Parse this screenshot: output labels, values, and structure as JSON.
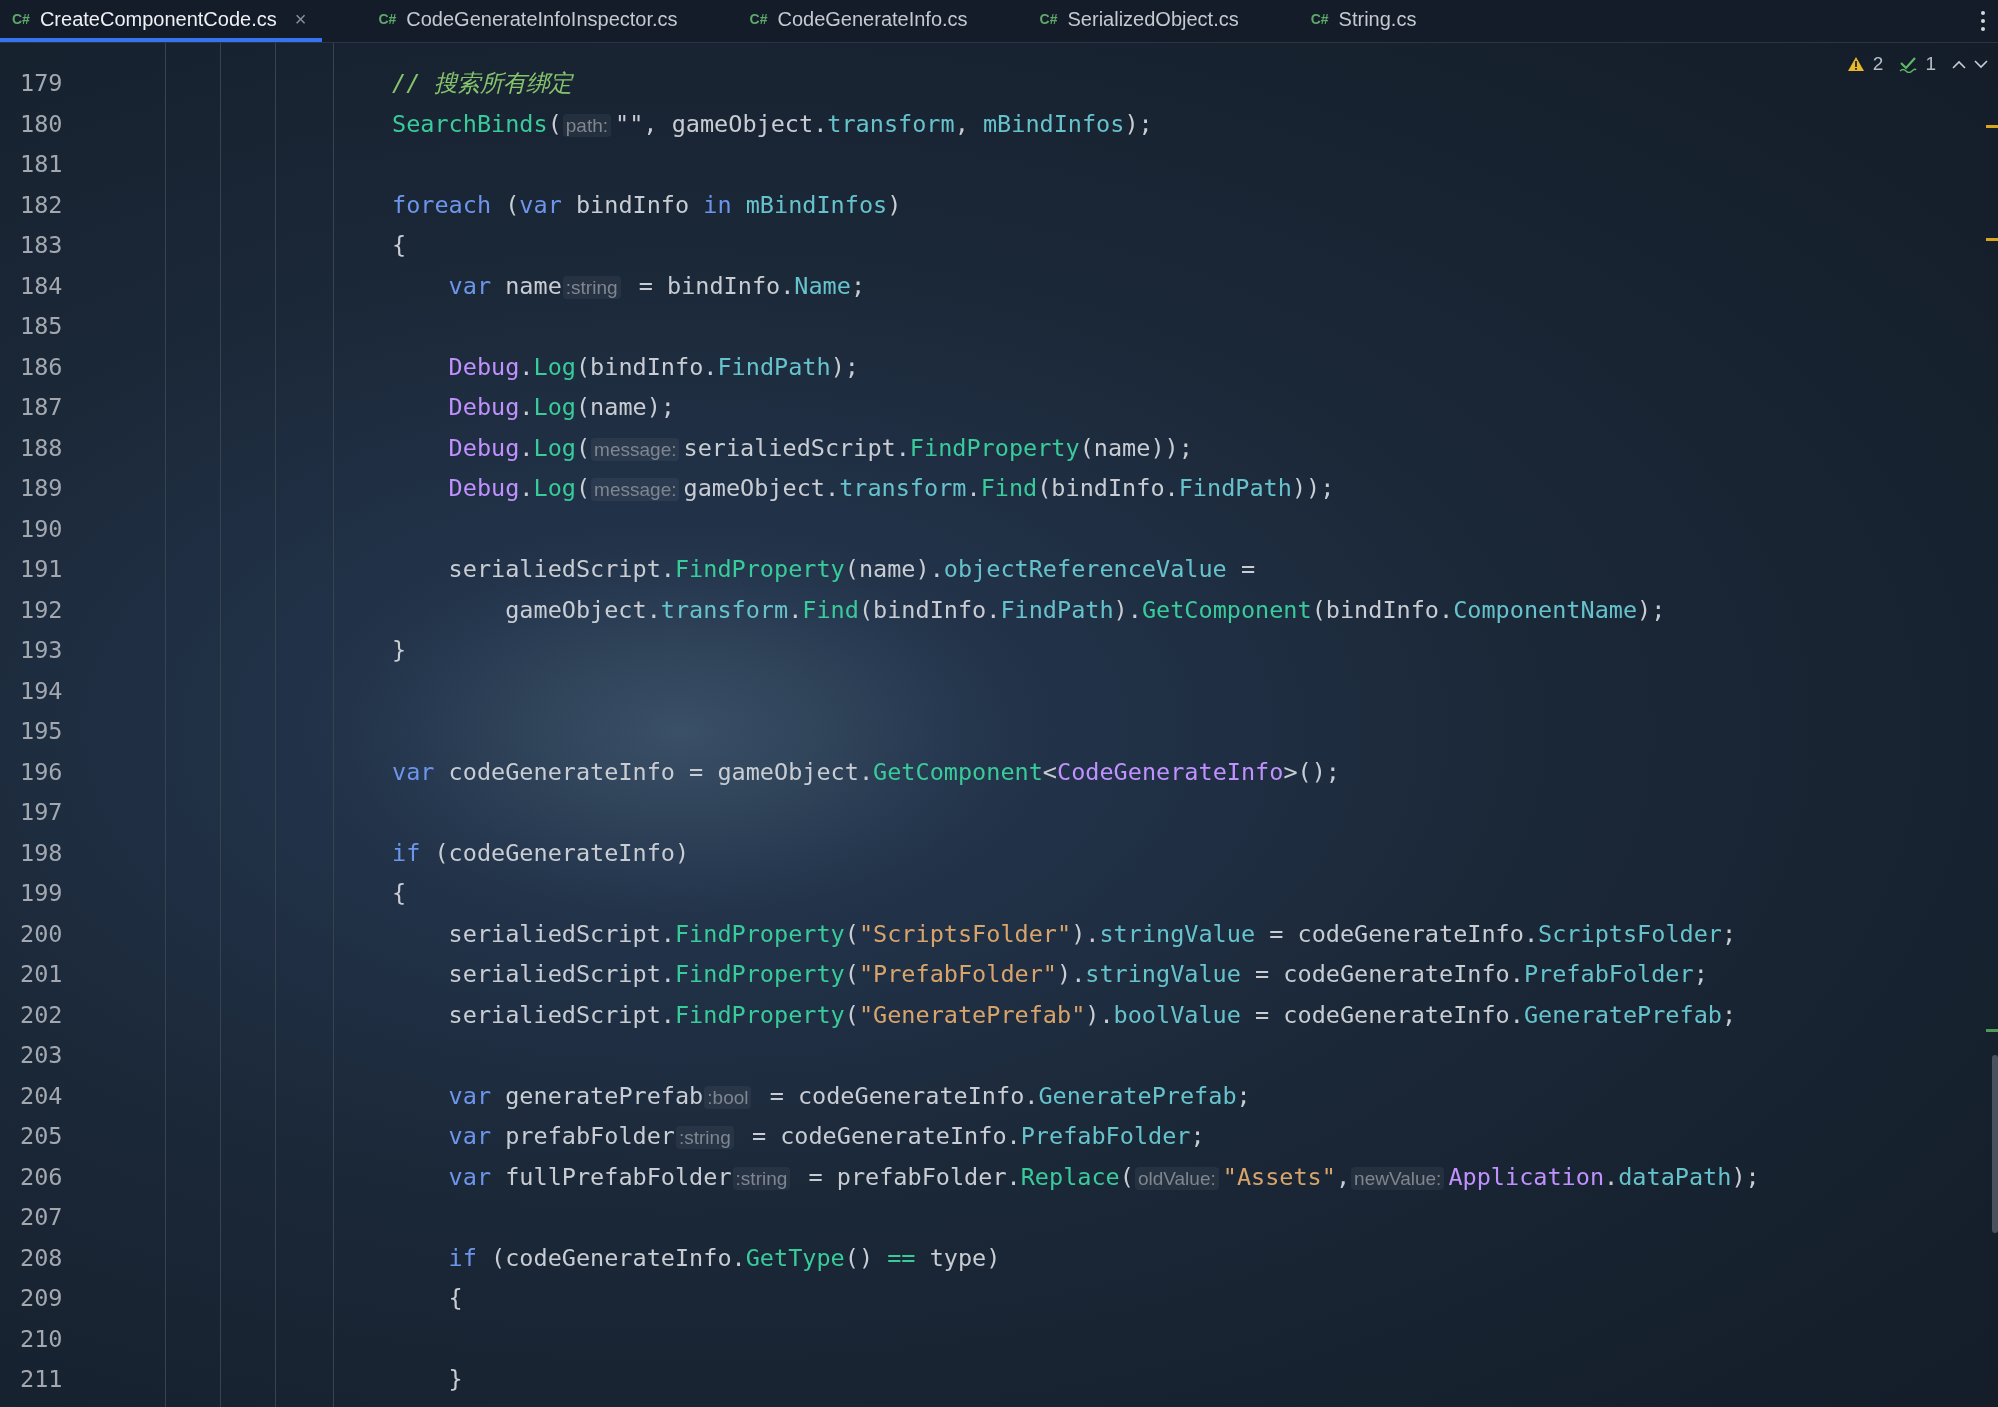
{
  "tabs": [
    {
      "icon_label": "C#",
      "label": "CreateComponentCode.cs",
      "selected": true,
      "close": "×"
    },
    {
      "icon_label": "C#",
      "label": "CodeGenerateInfoInspector.cs",
      "selected": false
    },
    {
      "icon_label": "C#",
      "label": "CodeGenerateInfo.cs",
      "selected": false
    },
    {
      "icon_label": "C#",
      "label": "SerializedObject.cs",
      "selected": false
    },
    {
      "icon_label": "C#",
      "label": "String.cs",
      "selected": false
    }
  ],
  "inspection": {
    "warnings": "2",
    "checks": "1"
  },
  "lines": [
    {
      "number": "179",
      "tokens": [
        {
          "kind": "comment",
          "text": "// 搜索所有绑定"
        }
      ]
    },
    {
      "number": "180",
      "tokens": [
        {
          "kind": "method",
          "text": "SearchBinds"
        },
        {
          "kind": "plain",
          "text": "("
        },
        {
          "kind": "hint",
          "text": "path:"
        },
        {
          "kind": "plain",
          "text": "\"\", gameObject."
        },
        {
          "kind": "prop",
          "text": "transform"
        },
        {
          "kind": "plain",
          "text": ", "
        },
        {
          "kind": "prop",
          "text": "mBindInfos"
        },
        {
          "kind": "plain",
          "text": ");"
        }
      ]
    },
    {
      "number": "181"
    },
    {
      "number": "182",
      "tokens": [
        {
          "kind": "kw",
          "text": "foreach"
        },
        {
          "kind": "plain",
          "text": " ("
        },
        {
          "kind": "kw",
          "text": "var"
        },
        {
          "kind": "plain",
          "text": " bindInfo "
        },
        {
          "kind": "kw",
          "text": "in"
        },
        {
          "kind": "prop",
          "text": " mBindInfos"
        },
        {
          "kind": "plain",
          "text": ")"
        }
      ]
    },
    {
      "number": "183",
      "tokens": [
        {
          "kind": "plain",
          "text": "{"
        }
      ]
    },
    {
      "number": "184",
      "tokens": [
        {
          "kind": "kw",
          "text": "    var"
        },
        {
          "kind": "plain",
          "text": " name"
        },
        {
          "kind": "hint",
          "text": ":string"
        },
        {
          "kind": "plain",
          "text": " = bindInfo."
        },
        {
          "kind": "prop",
          "text": "Name"
        },
        {
          "kind": "plain",
          "text": ";"
        }
      ]
    },
    {
      "number": "185"
    },
    {
      "number": "186",
      "tokens": [
        {
          "kind": "type",
          "text": "    Debug"
        },
        {
          "kind": "plain",
          "text": "."
        },
        {
          "kind": "method",
          "text": "Log"
        },
        {
          "kind": "plain",
          "text": "(bindInfo."
        },
        {
          "kind": "prop",
          "text": "FindPath"
        },
        {
          "kind": "plain",
          "text": ");"
        }
      ]
    },
    {
      "number": "187",
      "tokens": [
        {
          "kind": "type",
          "text": "    Debug"
        },
        {
          "kind": "plain",
          "text": "."
        },
        {
          "kind": "method",
          "text": "Log"
        },
        {
          "kind": "plain",
          "text": "(name);"
        }
      ]
    },
    {
      "number": "188",
      "tokens": [
        {
          "kind": "type",
          "text": "    Debug"
        },
        {
          "kind": "plain",
          "text": "."
        },
        {
          "kind": "method",
          "text": "Log"
        },
        {
          "kind": "plain",
          "text": "("
        },
        {
          "kind": "hint",
          "text": "message:"
        },
        {
          "kind": "plain",
          "text": "serialiedScript."
        },
        {
          "kind": "method",
          "text": "FindProperty"
        },
        {
          "kind": "plain",
          "text": "(name));"
        }
      ]
    },
    {
      "number": "189",
      "tokens": [
        {
          "kind": "type",
          "text": "    Debug"
        },
        {
          "kind": "plain",
          "text": "."
        },
        {
          "kind": "method",
          "text": "Log"
        },
        {
          "kind": "plain",
          "text": "("
        },
        {
          "kind": "hint",
          "text": "message:"
        },
        {
          "kind": "plain",
          "text": "gameObject."
        },
        {
          "kind": "prop",
          "text": "transform"
        },
        {
          "kind": "plain",
          "text": "."
        },
        {
          "kind": "method",
          "text": "Find"
        },
        {
          "kind": "plain",
          "text": "(bindInfo."
        },
        {
          "kind": "prop",
          "text": "FindPath"
        },
        {
          "kind": "plain",
          "text": "));"
        }
      ]
    },
    {
      "number": "190"
    },
    {
      "number": "191",
      "tokens": [
        {
          "kind": "plain",
          "text": "    serialiedScript."
        },
        {
          "kind": "method",
          "text": "FindProperty"
        },
        {
          "kind": "plain",
          "text": "(name)."
        },
        {
          "kind": "prop",
          "text": "objectReferenceValue"
        },
        {
          "kind": "plain",
          "text": " ="
        }
      ]
    },
    {
      "number": "192",
      "tokens": [
        {
          "kind": "plain",
          "text": "        gameObject."
        },
        {
          "kind": "prop",
          "text": "transform"
        },
        {
          "kind": "plain",
          "text": "."
        },
        {
          "kind": "method",
          "text": "Find"
        },
        {
          "kind": "plain",
          "text": "(bindInfo."
        },
        {
          "kind": "prop",
          "text": "FindPath"
        },
        {
          "kind": "plain",
          "text": ")."
        },
        {
          "kind": "method",
          "text": "GetComponent"
        },
        {
          "kind": "plain",
          "text": "(bindInfo."
        },
        {
          "kind": "prop",
          "text": "ComponentName"
        },
        {
          "kind": "plain",
          "text": ");"
        }
      ]
    },
    {
      "number": "193",
      "tokens": [
        {
          "kind": "plain",
          "text": "}"
        }
      ]
    },
    {
      "number": "194"
    },
    {
      "number": "195"
    },
    {
      "number": "196",
      "tokens": [
        {
          "kind": "kw",
          "text": "var"
        },
        {
          "kind": "plain",
          "text": " codeGenerateInfo = gameObject."
        },
        {
          "kind": "method",
          "text": "GetComponent"
        },
        {
          "kind": "plain",
          "text": "<"
        },
        {
          "kind": "type",
          "text": "CodeGenerateInfo"
        },
        {
          "kind": "plain",
          "text": ">();"
        }
      ]
    },
    {
      "number": "197"
    },
    {
      "number": "198",
      "tokens": [
        {
          "kind": "kw",
          "text": "if"
        },
        {
          "kind": "plain",
          "text": " (codeGenerateInfo)"
        }
      ]
    },
    {
      "number": "199",
      "tokens": [
        {
          "kind": "plain",
          "text": "{"
        }
      ]
    },
    {
      "number": "200",
      "tokens": [
        {
          "kind": "plain",
          "text": "    serialiedScript."
        },
        {
          "kind": "method",
          "text": "FindProperty"
        },
        {
          "kind": "plain",
          "text": "("
        },
        {
          "kind": "str",
          "text": "\"ScriptsFolder\""
        },
        {
          "kind": "plain",
          "text": ")."
        },
        {
          "kind": "prop",
          "text": "stringValue"
        },
        {
          "kind": "plain",
          "text": " = codeGenerateInfo."
        },
        {
          "kind": "prop",
          "text": "ScriptsFolder"
        },
        {
          "kind": "plain",
          "text": ";"
        }
      ]
    },
    {
      "number": "201",
      "tokens": [
        {
          "kind": "plain",
          "text": "    serialiedScript."
        },
        {
          "kind": "method",
          "text": "FindProperty"
        },
        {
          "kind": "plain",
          "text": "("
        },
        {
          "kind": "str",
          "text": "\"PrefabFolder\""
        },
        {
          "kind": "plain",
          "text": ")."
        },
        {
          "kind": "prop",
          "text": "stringValue"
        },
        {
          "kind": "plain",
          "text": " = codeGenerateInfo."
        },
        {
          "kind": "prop",
          "text": "PrefabFolder"
        },
        {
          "kind": "plain",
          "text": ";"
        }
      ]
    },
    {
      "number": "202",
      "tokens": [
        {
          "kind": "plain",
          "text": "    serialiedScript."
        },
        {
          "kind": "method",
          "text": "FindProperty"
        },
        {
          "kind": "plain",
          "text": "("
        },
        {
          "kind": "str",
          "text": "\"GeneratePrefab\""
        },
        {
          "kind": "plain",
          "text": ")."
        },
        {
          "kind": "prop",
          "text": "boolValue"
        },
        {
          "kind": "plain",
          "text": " = codeGenerateInfo."
        },
        {
          "kind": "prop",
          "text": "GeneratePrefab"
        },
        {
          "kind": "plain",
          "text": ";"
        }
      ]
    },
    {
      "number": "203"
    },
    {
      "number": "204",
      "tokens": [
        {
          "kind": "kw",
          "text": "    var"
        },
        {
          "kind": "plain",
          "text": " generatePrefab"
        },
        {
          "kind": "hint",
          "text": ":bool"
        },
        {
          "kind": "plain",
          "text": " = codeGenerateInfo."
        },
        {
          "kind": "prop",
          "text": "GeneratePrefab"
        },
        {
          "kind": "plain",
          "text": ";"
        }
      ]
    },
    {
      "number": "205",
      "tokens": [
        {
          "kind": "kw",
          "text": "    var"
        },
        {
          "kind": "plain",
          "text": " prefabFolder"
        },
        {
          "kind": "hint",
          "text": ":string"
        },
        {
          "kind": "plain",
          "text": " = codeGenerateInfo."
        },
        {
          "kind": "prop",
          "text": "PrefabFolder"
        },
        {
          "kind": "plain",
          "text": ";"
        }
      ]
    },
    {
      "number": "206",
      "tokens": [
        {
          "kind": "kw",
          "text": "    var"
        },
        {
          "kind": "plain",
          "text": " fullPrefabFolder"
        },
        {
          "kind": "hint",
          "text": ":string"
        },
        {
          "kind": "plain",
          "text": " = prefabFolder."
        },
        {
          "kind": "method",
          "text": "Replace"
        },
        {
          "kind": "plain",
          "text": "("
        },
        {
          "kind": "hint",
          "text": "oldValue:"
        },
        {
          "kind": "str",
          "text": "\"Assets\""
        },
        {
          "kind": "plain",
          "text": ","
        },
        {
          "kind": "hint",
          "text": "newValue:"
        },
        {
          "kind": "type",
          "text": "Application"
        },
        {
          "kind": "plain",
          "text": "."
        },
        {
          "kind": "prop",
          "text": "dataPath"
        },
        {
          "kind": "plain",
          "text": ");"
        }
      ]
    },
    {
      "number": "207"
    },
    {
      "number": "208",
      "tokens": [
        {
          "kind": "kw",
          "text": "    if"
        },
        {
          "kind": "plain",
          "text": " (codeGenerateInfo."
        },
        {
          "kind": "method",
          "text": "GetType"
        },
        {
          "kind": "plain",
          "text": "() "
        },
        {
          "kind": "op",
          "text": "=="
        },
        {
          "kind": "plain",
          "text": " type)"
        }
      ]
    },
    {
      "number": "209",
      "tokens": [
        {
          "kind": "plain",
          "text": "    {"
        }
      ]
    },
    {
      "number": "210"
    },
    {
      "number": "211",
      "tokens": [
        {
          "kind": "plain",
          "text": "    }"
        }
      ]
    }
  ]
}
